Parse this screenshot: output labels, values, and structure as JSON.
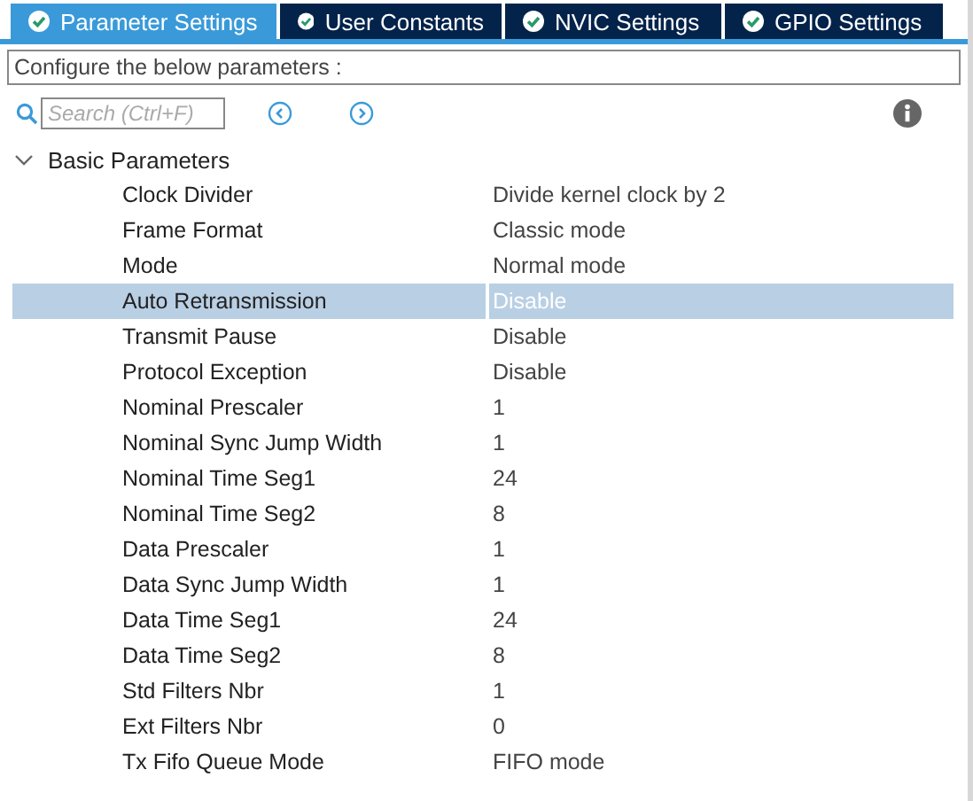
{
  "tabs": [
    {
      "label": "Parameter Settings",
      "selected": true
    },
    {
      "label": "User Constants",
      "selected": false
    },
    {
      "label": "NVIC Settings",
      "selected": false
    },
    {
      "label": "GPIO Settings",
      "selected": false
    }
  ],
  "description": "Configure the below parameters :",
  "search": {
    "placeholder": "Search (Ctrl+F)"
  },
  "tree": {
    "label": "Basic Parameters",
    "expanded": true,
    "rows": [
      {
        "name": "Clock Divider",
        "value": "Divide kernel clock by 2",
        "selected": false
      },
      {
        "name": "Frame Format",
        "value": "Classic mode",
        "selected": false
      },
      {
        "name": "Mode",
        "value": "Normal mode",
        "selected": false
      },
      {
        "name": "Auto Retransmission",
        "value": "Disable",
        "selected": true
      },
      {
        "name": "Transmit Pause",
        "value": "Disable",
        "selected": false
      },
      {
        "name": "Protocol Exception",
        "value": "Disable",
        "selected": false
      },
      {
        "name": "Nominal Prescaler",
        "value": "1",
        "selected": false
      },
      {
        "name": "Nominal Sync Jump Width",
        "value": "1",
        "selected": false
      },
      {
        "name": "Nominal Time Seg1",
        "value": "24",
        "selected": false
      },
      {
        "name": "Nominal Time Seg2",
        "value": "8",
        "selected": false
      },
      {
        "name": "Data Prescaler",
        "value": "1",
        "selected": false
      },
      {
        "name": "Data Sync Jump Width",
        "value": "1",
        "selected": false
      },
      {
        "name": "Data Time Seg1",
        "value": "24",
        "selected": false
      },
      {
        "name": "Data Time Seg2",
        "value": "8",
        "selected": false
      },
      {
        "name": "Std Filters Nbr",
        "value": "1",
        "selected": false
      },
      {
        "name": "Ext Filters Nbr",
        "value": "0",
        "selected": false
      },
      {
        "name": "Tx Fifo Queue Mode",
        "value": "FIFO mode",
        "selected": false
      }
    ]
  }
}
